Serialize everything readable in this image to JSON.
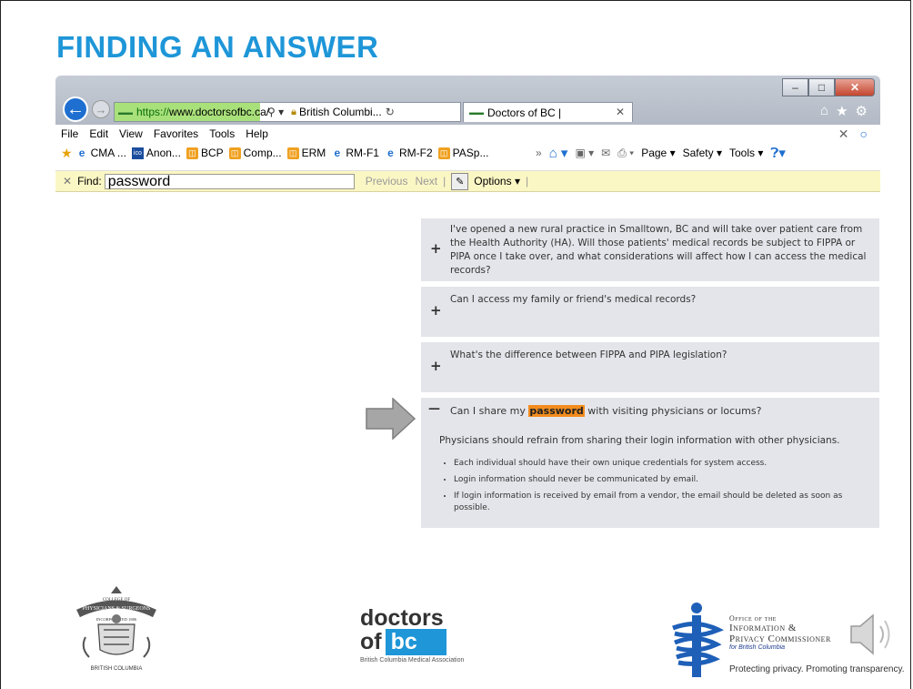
{
  "slide": {
    "title": "FINDING AN ANSWER"
  },
  "browser": {
    "address": {
      "protocol": "https://",
      "host": "www.doctorsofbc.ca/",
      "site_name": "British Columbi...",
      "icons": [
        "search-icon",
        "dropdown-icon",
        "lock-icon",
        "reload-icon"
      ]
    },
    "tab_title": "Doctors of BC |",
    "window_controls": [
      "minimize",
      "maximize",
      "close"
    ],
    "toolbar_icons": [
      "home-icon",
      "favorites-star-icon",
      "settings-gear-icon"
    ],
    "menu": [
      "File",
      "Edit",
      "View",
      "Favorites",
      "Tools",
      "Help"
    ],
    "favorites": [
      {
        "label": "CMA ...",
        "icon": "ie-icon"
      },
      {
        "label": "Anon...",
        "icon": "ico-icon"
      },
      {
        "label": "BCP",
        "icon": "feed-icon"
      },
      {
        "label": "Comp...",
        "icon": "feed-icon"
      },
      {
        "label": "ERM",
        "icon": "feed-icon"
      },
      {
        "label": "RM-F1",
        "icon": "ie-icon"
      },
      {
        "label": "RM-F2",
        "icon": "ie-icon"
      },
      {
        "label": "PASp...",
        "icon": "feed-icon"
      }
    ],
    "commands": {
      "page": "Page",
      "safety": "Safety",
      "tools": "Tools"
    },
    "find": {
      "label": "Find:",
      "value": "password",
      "previous": "Previous",
      "next": "Next",
      "options": "Options"
    }
  },
  "faq": [
    {
      "question": "I've opened a new rural practice in Smalltown, BC and will take over patient care from the Health Authority (HA). Will those patients' medical records be subject to FIPPA or PIPA once I take over, and what considerations will affect how I can access the medical records?",
      "expanded": false
    },
    {
      "question": "Can I access my family or friend's medical records?",
      "expanded": false
    },
    {
      "question": "What's the difference between FIPPA and PIPA legislation?",
      "expanded": false
    },
    {
      "question_before": "Can I share my",
      "question_highlight": "password",
      "question_after": "with visiting physicians or locums?",
      "expanded": true,
      "answer": "Physicians should refrain from sharing their login information with other physicians.",
      "bullets": [
        "Each individual should have their own unique credentials for system access.",
        "Login information should never be communicated by email.",
        "If login information is received by email from a vendor, the email should be deleted as soon as possible."
      ]
    }
  ],
  "logos": {
    "cps": {
      "top_text": "COLLEGE OF",
      "band_text": "PHYSICIANS & SURGEONS",
      "ribbon_text": "INCORPORATED 1886",
      "bottom_text": "BRITISH COLUMBIA"
    },
    "dbc": {
      "line1": "doctors",
      "of": "of",
      "bc": "bc",
      "subtitle": "British Columbia Medical Association"
    },
    "oipc": {
      "line1": "Office of the",
      "line2": "Information &",
      "line3": "Privacy Commissioner",
      "line4": "for British Columbia",
      "tagline": "Protecting privacy. Promoting transparency."
    }
  },
  "colors": {
    "title": "#1e96d8",
    "highlight": "#f28c1e",
    "find_bar": "#fbf7c5",
    "faq_bg": "#e4e5ea",
    "brand_blue": "#1e96d8"
  }
}
